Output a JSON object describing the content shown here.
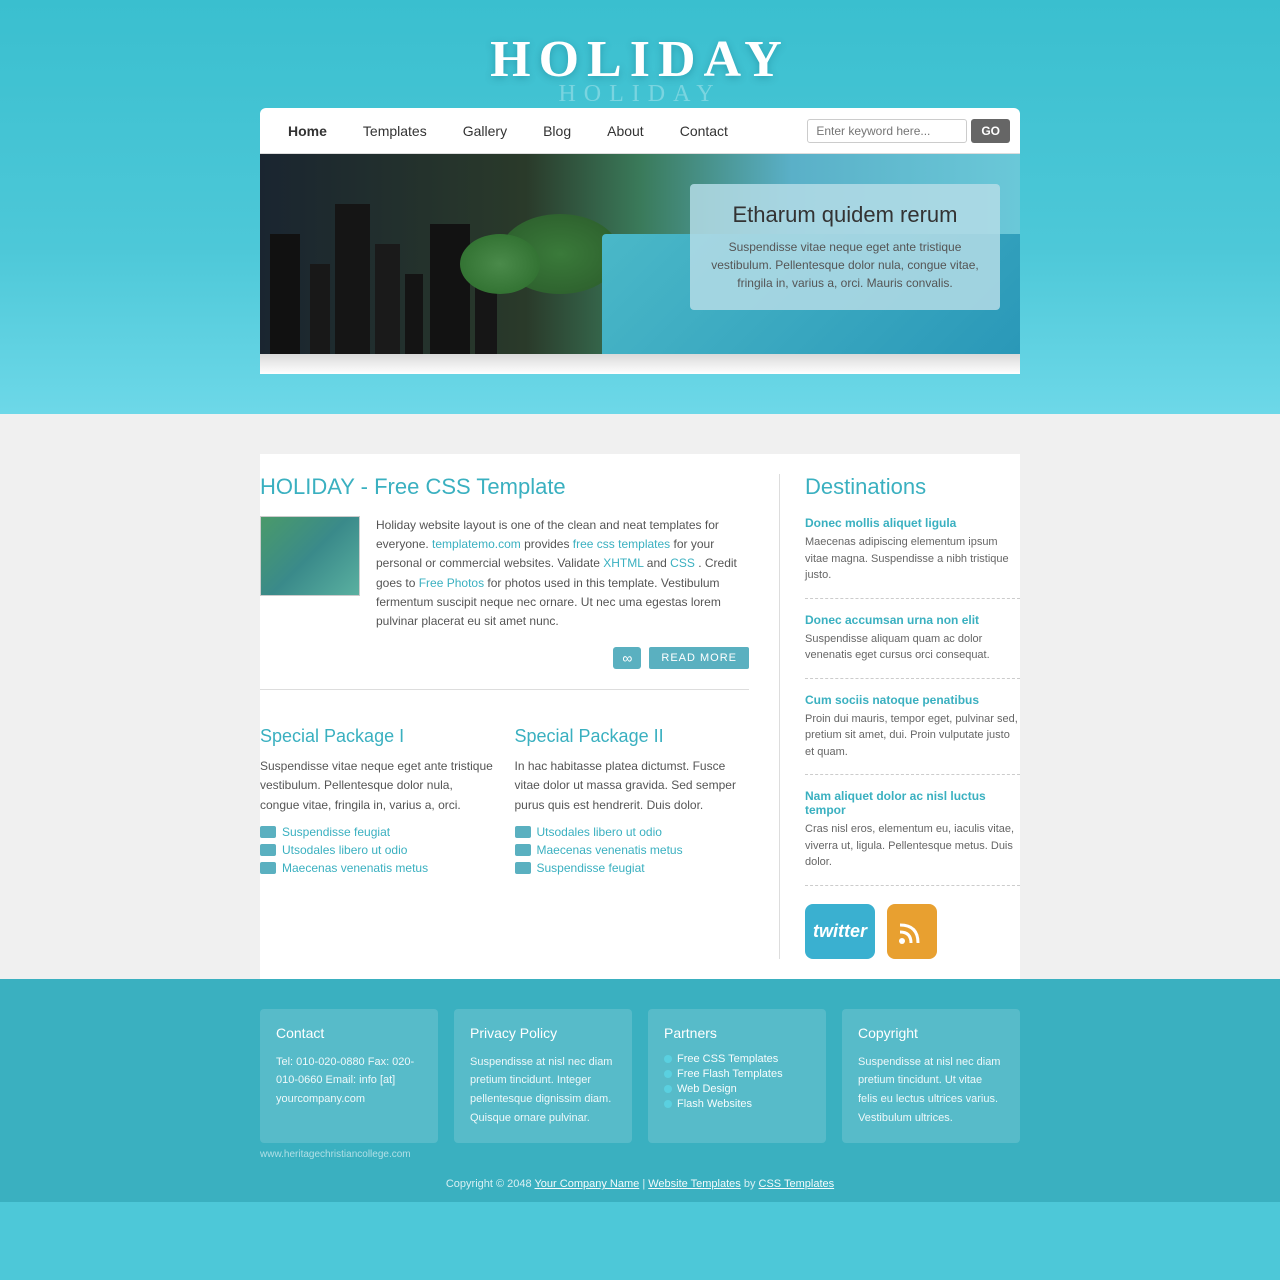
{
  "site": {
    "title": "HOLIDAY",
    "title_reflection": "HOLIDAY"
  },
  "nav": {
    "links": [
      {
        "label": "Home",
        "active": true
      },
      {
        "label": "Templates",
        "active": false
      },
      {
        "label": "Gallery",
        "active": false
      },
      {
        "label": "Blog",
        "active": false
      },
      {
        "label": "About",
        "active": false
      },
      {
        "label": "Contact",
        "active": false
      }
    ],
    "search_placeholder": "Enter keyword here...",
    "search_button": "GO"
  },
  "hero": {
    "title": "Etharum quidem rerum",
    "description": "Suspendisse vitae neque eget ante tristique vestibulum. Pellentesque dolor nula, congue vitae, fringila in, varius a, orci. Mauris convalis."
  },
  "about": {
    "section_title": "HOLIDAY - Free CSS Template",
    "body1": "Holiday website layout is one of the clean and neat templates for everyone.",
    "link1": "templatemo.com",
    "body2": " provides ",
    "link2": "free css templates",
    "body3": " for your personal or commercial websites. Validate ",
    "link3": "XHTML",
    "body4": " and ",
    "link4": "CSS",
    "body5": ". Credit goes to ",
    "link5": "Free Photos",
    "body6": " for photos used in this template. Vestibulum fermentum suscipit neque nec ornare. Ut nec uma egestas lorem pulvinar placerat eu sit amet nunc.",
    "read_more": "READ MORE"
  },
  "packages": [
    {
      "title": "Special Package I",
      "desc": "Suspendisse vitae neque eget ante tristique vestibulum. Pellentesque dolor nula, congue vitae, fringila in, varius a, orci.",
      "items": [
        "Suspendisse feugiat",
        "Utsodales libero ut odio",
        "Maecenas venenatis metus"
      ]
    },
    {
      "title": "Special Package II",
      "desc": "In hac habitasse platea dictumst. Fusce vitae dolor ut massa gravida. Sed semper purus quis est hendrerit. Duis dolor.",
      "items": [
        "Utsodales libero ut odio",
        "Maecenas venenatis metus",
        "Suspendisse feugiat"
      ]
    }
  ],
  "destinations": {
    "title": "Destinations",
    "items": [
      {
        "title": "Donec mollis aliquet ligula",
        "desc": "Maecenas adipiscing elementum ipsum vitae magna. Suspendisse a nibh tristique justo."
      },
      {
        "title": "Donec accumsan urna non elit",
        "desc": "Suspendisse aliquam quam ac dolor venenatis eget cursus orci consequat."
      },
      {
        "title": "Cum sociis natoque penatibus",
        "desc": "Proin dui mauris, tempor eget, pulvinar sed, pretium sit amet, dui. Proin vulputate justo et quam."
      },
      {
        "title": "Nam aliquet dolor ac nisl luctus tempor",
        "desc": "Cras nisl eros, elementum eu, iaculis vitae, viverra ut, ligula. Pellentesque metus. Duis dolor."
      }
    ]
  },
  "footer": {
    "columns": [
      {
        "title": "Contact",
        "content": "Tel: 010-020-0880\nFax: 020-010-0660\nEmail: info [at] yourcompany.com"
      },
      {
        "title": "Privacy Policy",
        "content": "Suspendisse at nisl nec diam pretium tincidunt. Integer pellentesque dignissim diam. Quisque ornare pulvinar."
      },
      {
        "title": "Partners",
        "links": [
          "Free CSS Templates",
          "Free Flash Templates",
          "Web Design",
          "Flash Websites"
        ]
      },
      {
        "title": "Copyright",
        "content": "Suspendisse at nisl nec diam pretium tincidunt. Ut vitae felis eu lectus ultrices varius. Vestibulum ultrices."
      }
    ],
    "bottom": "Copyright © 2048",
    "company": "Your Company Name",
    "sep1": " | ",
    "templates_link": "Website Templates",
    "sep2": " by ",
    "css_link": "CSS Templates",
    "watermark": "www.heritagechristiancollege.com"
  }
}
